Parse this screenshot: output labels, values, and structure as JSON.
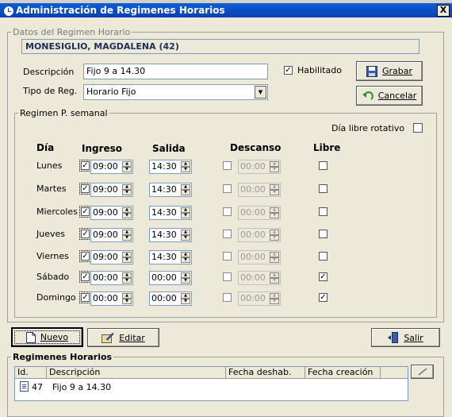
{
  "window": {
    "title": "Administración de Regimenes Horarios",
    "close_glyph": "X"
  },
  "datos": {
    "legend": "Datos del Regimen Horario",
    "employee": "MONESIGLIO, MAGDALENA (42)",
    "descripcion_label": "Descripción",
    "descripcion_value": "Fijo 9 a 14.30",
    "tipo_label": "Tipo de Reg.",
    "tipo_value": "Horario Fijo",
    "habilitado_label": "Habilitado",
    "habilitado_checked": true,
    "grabar_label": "Grabar",
    "cancelar_label": "Cancelar"
  },
  "semanal": {
    "legend": "Regimen P. semanal",
    "dia_libre_rotativo_label": "Día libre rotativo",
    "headers": {
      "dia": "Día",
      "ingreso": "Ingreso",
      "salida": "Salida",
      "descanso": "Descanso",
      "libre": "Libre"
    },
    "check_glyph": "✓",
    "rows": [
      {
        "day": "Lunes",
        "ingreso": "09:00",
        "salida": "14:30",
        "descanso": "00:00",
        "libre": false
      },
      {
        "day": "Martes",
        "ingreso": "09:00",
        "salida": "14:30",
        "descanso": "00:00",
        "libre": false
      },
      {
        "day": "Miercoles",
        "ingreso": "09:00",
        "salida": "14:30",
        "descanso": "00:00",
        "libre": false
      },
      {
        "day": "Jueves",
        "ingreso": "09:00",
        "salida": "14:30",
        "descanso": "00:00",
        "libre": false
      },
      {
        "day": "Viernes",
        "ingreso": "09:00",
        "salida": "14:30",
        "descanso": "00:00",
        "libre": false
      },
      {
        "day": "Sábado",
        "ingreso": "00:00",
        "salida": "00:00",
        "descanso": "00:00",
        "libre": true
      },
      {
        "day": "Domingo",
        "ingreso": "00:00",
        "salida": "00:00",
        "descanso": "00:00",
        "libre": true
      }
    ]
  },
  "toolbar": {
    "nuevo_label": "Nuevo",
    "editar_label": "Editar",
    "salir_label": "Salir"
  },
  "regimenes": {
    "legend": "Regimenes Horarios",
    "columns": [
      "Id.",
      "Descripción",
      "Fecha deshab.",
      "Fecha creación"
    ],
    "rows": [
      {
        "id": "47",
        "descripcion": "Fijo 9 a 14.30",
        "fecha_deshab": "",
        "fecha_creacion": ""
      }
    ]
  }
}
